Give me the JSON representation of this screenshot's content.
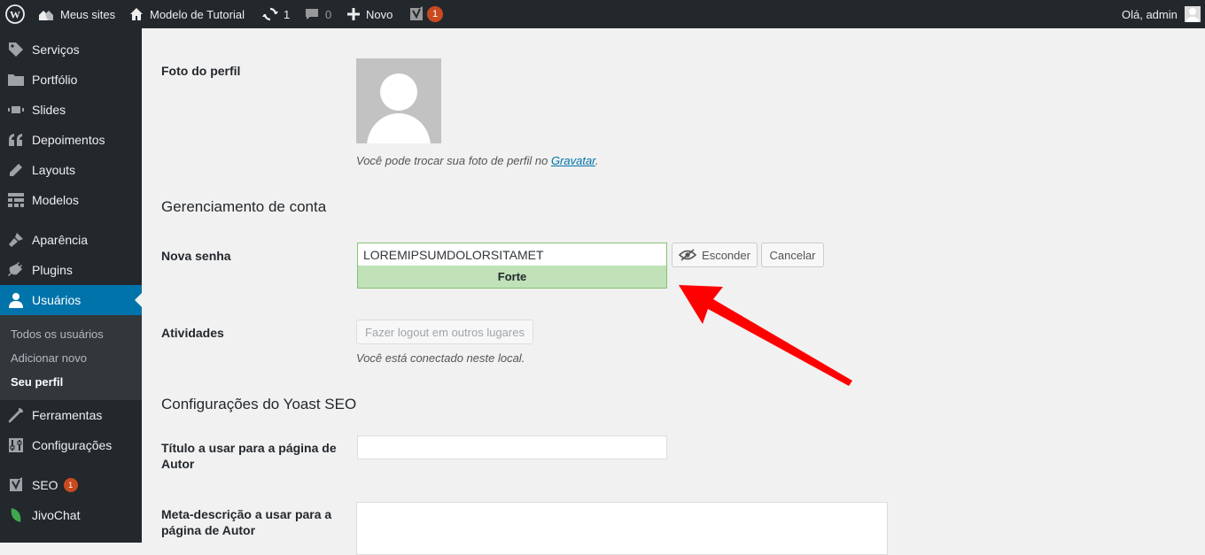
{
  "adminbar": {
    "my_sites": "Meus sites",
    "site_name": "Modelo de Tutorial",
    "updates_count": "1",
    "comments_count": "0",
    "new_label": "Novo",
    "yoast_count": "1",
    "greeting": "Olá, admin"
  },
  "sidebar": {
    "items": [
      {
        "label": "Serviços",
        "icon": "tag-icon"
      },
      {
        "label": "Portfólio",
        "icon": "folder-icon"
      },
      {
        "label": "Slides",
        "icon": "slides-icon"
      },
      {
        "label": "Depoimentos",
        "icon": "quote-icon"
      },
      {
        "label": "Layouts",
        "icon": "pencil-icon"
      },
      {
        "label": "Modelos",
        "icon": "grid-icon"
      },
      {
        "label": "Aparência",
        "icon": "brush-icon"
      },
      {
        "label": "Plugins",
        "icon": "plug-icon"
      },
      {
        "label": "Usuários",
        "icon": "user-icon"
      },
      {
        "label": "Ferramentas",
        "icon": "wrench-icon"
      },
      {
        "label": "Configurações",
        "icon": "settings-icon"
      },
      {
        "label": "SEO",
        "icon": "yoast-icon",
        "badge": "1"
      },
      {
        "label": "JivoChat",
        "icon": "leaf-icon"
      }
    ],
    "submenu": [
      "Todos os usuários",
      "Adicionar novo",
      "Seu perfil"
    ],
    "colors": {
      "background": "#23282d",
      "current": "#0073aa"
    }
  },
  "profile_photo": {
    "label": "Foto do perfil",
    "desc_prefix": "Você pode trocar sua foto de perfil no ",
    "desc_link": "Gravatar",
    "desc_suffix": "."
  },
  "account": {
    "section_title": "Gerenciamento de conta",
    "new_password_label": "Nova senha",
    "password_value": "LOREMIPSUMDOLORSITAMET",
    "hide_button": "Esconder",
    "cancel_button": "Cancelar",
    "strength": "Forte",
    "activities_label": "Atividades",
    "logout_button": "Fazer logout em outros lugares",
    "connected_desc": "Você está conectado neste local."
  },
  "yoast": {
    "section_title": "Configurações do Yoast SEO",
    "title_label": "Título a usar para a página de Autor",
    "meta_label": "Meta-descrição a usar para a página de Autor",
    "title_value": "",
    "meta_value": ""
  },
  "annotation": {
    "arrow_color": "#ff0000"
  }
}
